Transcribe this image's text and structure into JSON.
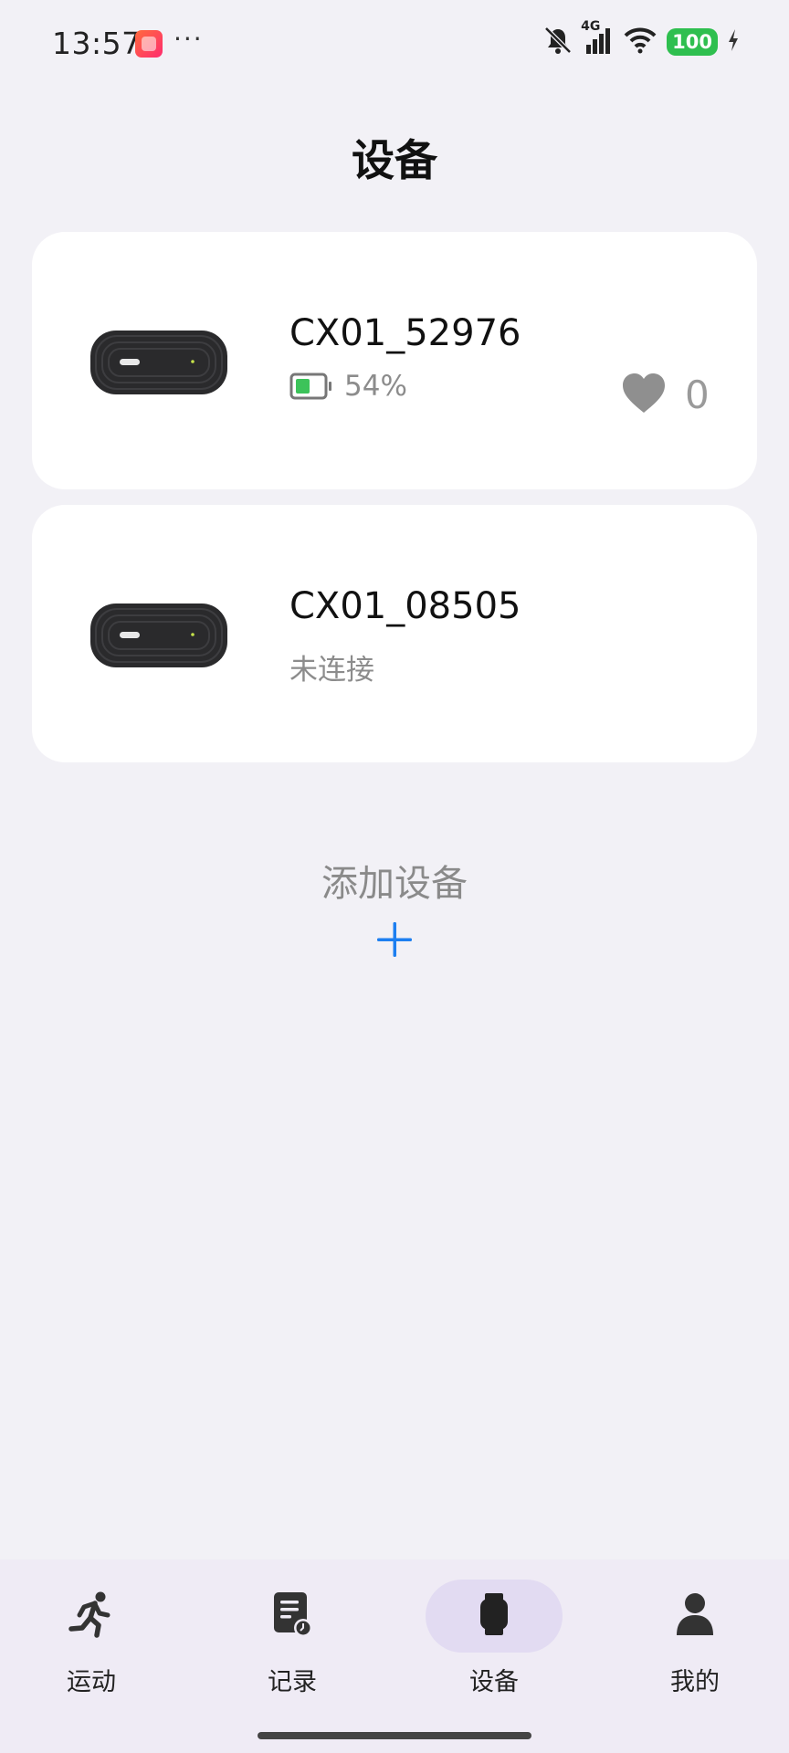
{
  "status_bar": {
    "time": "13:57",
    "app_icon": "taobao-app-icon",
    "more": "···",
    "network": "4G",
    "battery": "100",
    "icons": [
      "mute-bell-icon",
      "cellular-signal-icon",
      "wifi-icon",
      "battery-icon",
      "charging-icon"
    ]
  },
  "header": {
    "title": "设备"
  },
  "devices": [
    {
      "name": "CX01_52976",
      "battery": "54%",
      "heart_count": "0",
      "icon": "device-image"
    },
    {
      "name": "CX01_08505",
      "status": "未连接",
      "icon": "device-image"
    }
  ],
  "add_device": {
    "label": "添加设备",
    "icon": "plus-icon"
  },
  "nav": {
    "items": [
      {
        "label": "运动",
        "icon": "running-icon"
      },
      {
        "label": "记录",
        "icon": "record-icon"
      },
      {
        "label": "设备",
        "icon": "watch-icon"
      },
      {
        "label": "我的",
        "icon": "person-icon"
      }
    ],
    "active": "设备"
  },
  "colors": {
    "accent": "#1d7ff0",
    "battery_green": "#3cc35a",
    "nav_active_bg": "#e2dbf2",
    "background": "#f2f1f6"
  }
}
